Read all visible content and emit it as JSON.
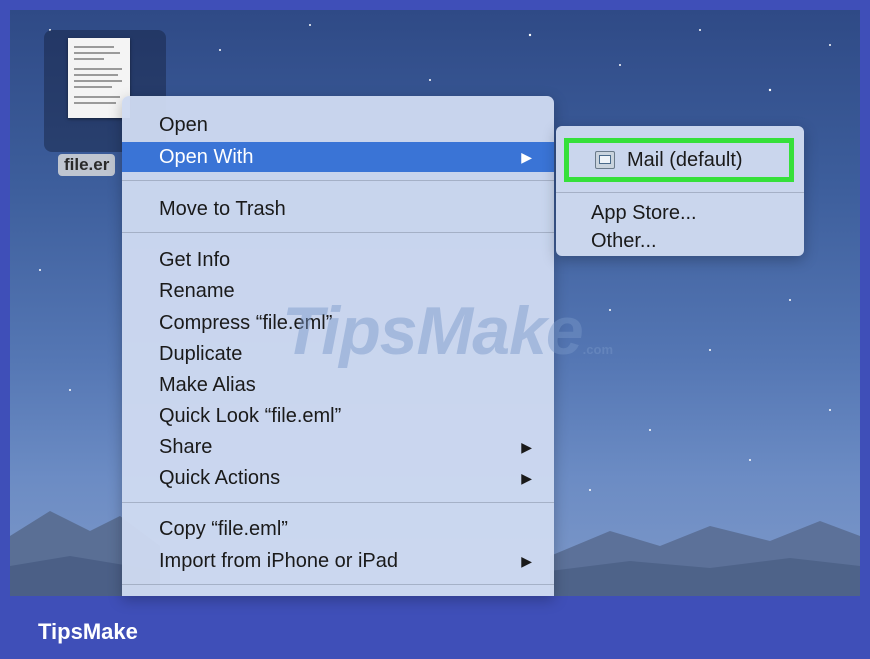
{
  "desktop": {
    "file_label": "file.er"
  },
  "context_menu": {
    "items": [
      {
        "label": "Open"
      },
      {
        "label": "Open With",
        "submenu": true,
        "highlighted": true
      },
      {
        "label": "Move to Trash"
      },
      {
        "label": "Get Info"
      },
      {
        "label": "Rename"
      },
      {
        "label": "Compress “file.eml”"
      },
      {
        "label": "Duplicate"
      },
      {
        "label": "Make Alias"
      },
      {
        "label": "Quick Look “file.eml”"
      },
      {
        "label": "Share",
        "submenu": true
      },
      {
        "label": "Quick Actions",
        "submenu": true
      },
      {
        "label": "Copy “file.eml”"
      },
      {
        "label": "Import from iPhone or iPad",
        "submenu": true
      }
    ],
    "arrow_glyph": "▶"
  },
  "open_with_submenu": {
    "default_app": "Mail (default)",
    "default_app_icon": "mail-app-icon",
    "items": [
      "App Store...",
      "Other..."
    ]
  },
  "watermark": {
    "text": "TipsMake",
    "suffix": ".com"
  },
  "footer": {
    "brand": "TipsMake"
  },
  "colors": {
    "frame": "#3f4fb8",
    "highlight": "#3a74d6",
    "green_box": "#35e03a"
  }
}
